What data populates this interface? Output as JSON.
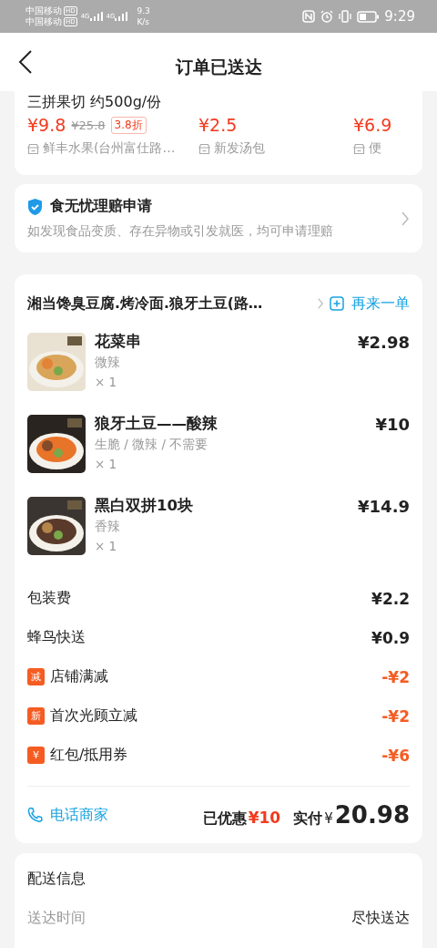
{
  "status_bar": {
    "carriers": [
      {
        "name": "中国移动",
        "badge": "HD",
        "network": "4G"
      },
      {
        "name": "中国移动",
        "badge": "HD",
        "network": "4G"
      }
    ],
    "speed_value": "9.3",
    "speed_unit": "K/s",
    "time": "9:29"
  },
  "header": {
    "title": "订单已送达"
  },
  "recommendations": {
    "partial_title": "三拼果切 约500g/份",
    "items": [
      {
        "price": "¥9.8",
        "original_price": "¥25.8",
        "discount": "3.8折",
        "shop": "鲜丰水果(台州富仕路…"
      },
      {
        "price": "¥2.5",
        "shop": "新发汤包"
      },
      {
        "price": "¥6.9",
        "shop": "便"
      }
    ]
  },
  "insurance": {
    "title": "食无忧理赔申请",
    "description": "如发现食品变质、存在异物或引发就医，均可申请理赔"
  },
  "order": {
    "shop_name": "湘当馋臭豆腐.烤冷面.狼牙土豆(路…",
    "reorder": "再来一单",
    "items": [
      {
        "name": "花菜串",
        "options": "微辣",
        "quantity": "× 1",
        "price": "¥2.98",
        "kind": "picture"
      },
      {
        "name": "狼牙土豆——酸辣",
        "options": "生脆 / 微辣 / 不需要",
        "quantity": "× 1",
        "price": "¥10",
        "kind": "picture"
      },
      {
        "name": "黑白双拼10块",
        "options": "香辣",
        "quantity": "× 1",
        "price": "¥14.9",
        "kind": "picture"
      }
    ],
    "charges": [
      {
        "kind": "fee",
        "label": "包装费",
        "amount": "¥2.2"
      },
      {
        "kind": "fee",
        "label": "蜂鸟快送",
        "amount": "¥0.9"
      },
      {
        "kind": "discount",
        "badge": "减",
        "label": "店铺满减",
        "amount": "-¥2"
      },
      {
        "kind": "discount",
        "badge": "新",
        "label": "首次光顾立减",
        "amount": "-¥2"
      },
      {
        "kind": "discount",
        "badge": "¥",
        "label": "红包/抵用券",
        "amount": "-¥6"
      }
    ],
    "call": "电话商家",
    "saved_label": "已优惠",
    "saved_amount": "¥10",
    "paid_label": "实付",
    "paid_currency": "¥",
    "paid_amount": "20.98"
  },
  "delivery": {
    "title": "配送信息",
    "rows": [
      {
        "label": "送达时间",
        "value": "尽快送达"
      }
    ]
  }
}
